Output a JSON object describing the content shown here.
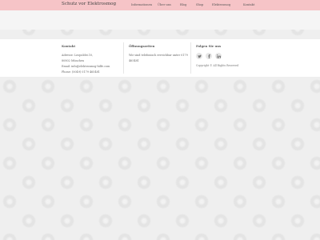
{
  "header": {
    "brand": "Schutz vor Elektrosmog",
    "nav": [
      {
        "label": "Informationen"
      },
      {
        "label": "Über uns"
      },
      {
        "label": "Blog"
      },
      {
        "label": "Shop"
      },
      {
        "label": "Elektrosmog"
      },
      {
        "label": "Kontakt"
      }
    ]
  },
  "footer": {
    "contact": {
      "title": "Kontakt",
      "lines": [
        "Adresse: Leopoldst.10,",
        "80802 München",
        "Email: info@elektrosmog-hilfe.com",
        "Phone: (0049) 0179 465481"
      ]
    },
    "hours": {
      "title": "Öffnungszeiten",
      "lines": [
        "Wir sind telefonisch erreichbar unter 0179",
        "465481"
      ]
    },
    "follow": {
      "title": "Folgen Sie uns",
      "icons": [
        "twitter-icon",
        "facebook-icon",
        "linkedin-icon"
      ],
      "copyright": "Copyright © All Rights Reserved"
    }
  }
}
